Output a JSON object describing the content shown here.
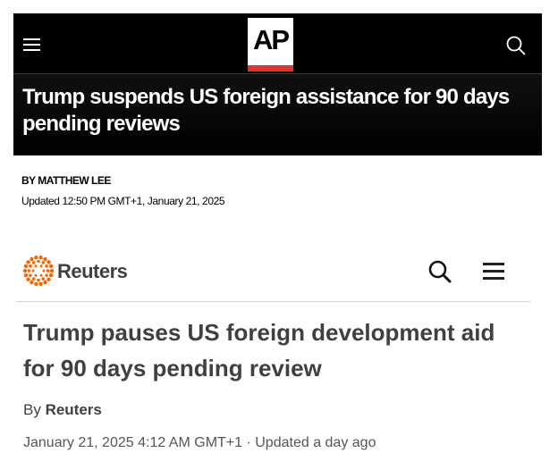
{
  "ap": {
    "logo": "AP",
    "headline": "Trump suspends US foreign assistance for 90 days pending reviews",
    "byline": "BY MATTHEW LEE",
    "updated": "Updated 12:50 PM GMT+1, January 21, 2025",
    "icons": {
      "menu": "hamburger-menu-icon",
      "search": "search-icon"
    },
    "colors": {
      "header_bg": "#000000",
      "logo_bar": "#e4322b"
    }
  },
  "reuters": {
    "brand": "Reuters",
    "headline": "Trump pauses US foreign development aid for 90 days pending review",
    "byline_prefix": "By",
    "author": "Reuters",
    "date": "January 21, 2025 4:12 AM GMT+1 · Updated a day ago",
    "icons": {
      "logo": "reuters-dots-logo",
      "search": "search-icon",
      "menu": "hamburger-menu-icon"
    },
    "colors": {
      "brand_orange": "#fa6400",
      "text": "#404040"
    }
  }
}
